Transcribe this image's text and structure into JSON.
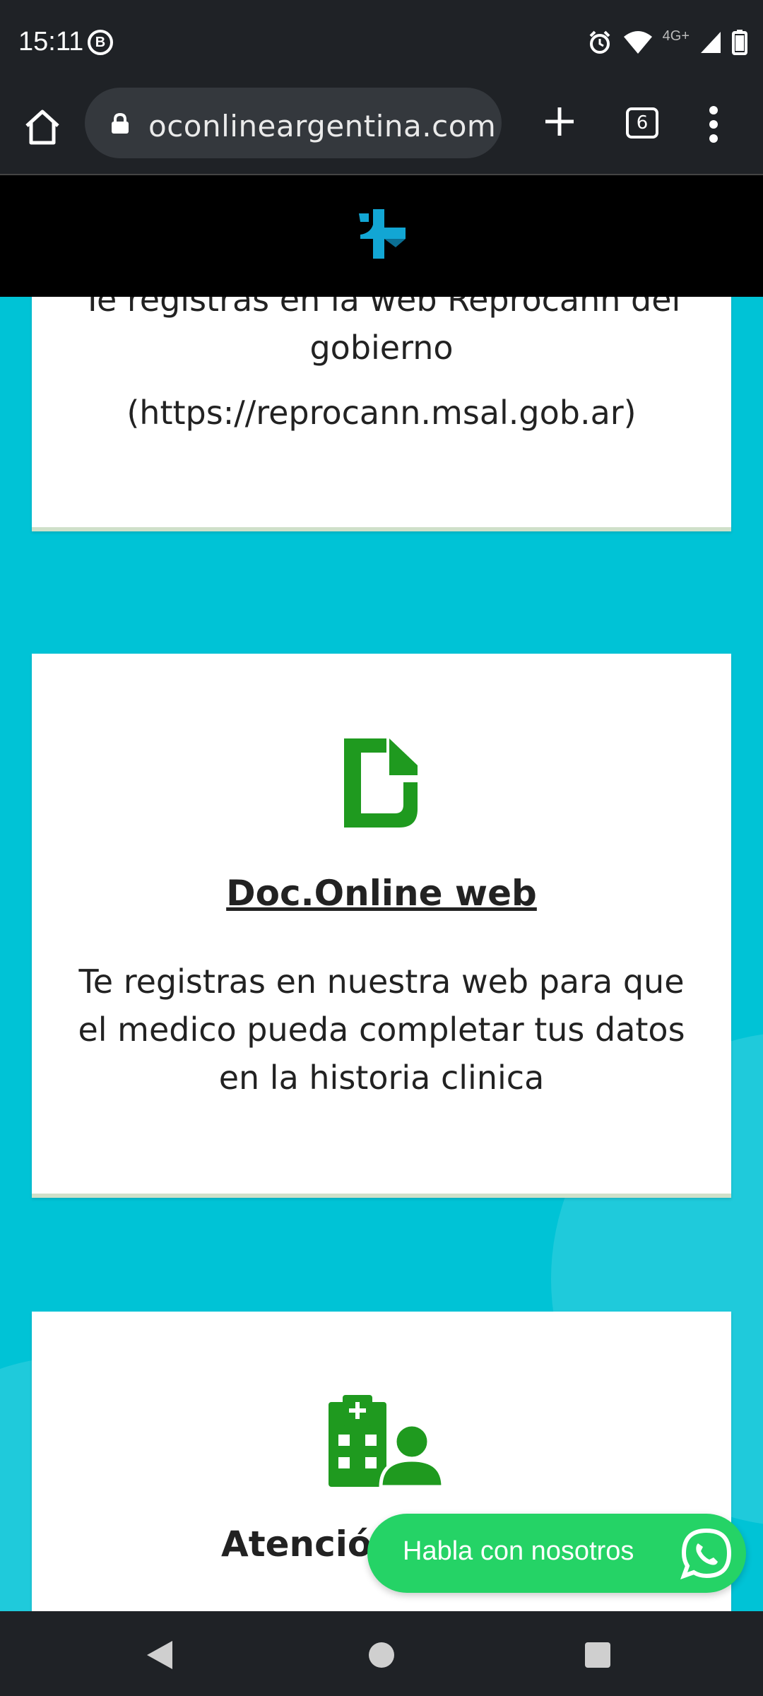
{
  "status_bar": {
    "time": "15:11",
    "badge": "B",
    "network": "4G+"
  },
  "browser": {
    "url": "oconlineargentina.com",
    "tab_count": "6"
  },
  "cards": [
    {
      "text": "Te registras en la web Reprocann del gobierno",
      "link_text": "(https://reprocann.msal.gob.ar)"
    },
    {
      "title": "Doc.Online web",
      "description": "Te registras en nuestra web para que el medico pueda completar tus datos en la historia clinica"
    },
    {
      "title": "Atención"
    }
  ],
  "whatsapp": {
    "label": "Habla con nosotros"
  },
  "colors": {
    "page_background": "#00c3d6",
    "accent_green": "#1f9a1f",
    "whatsapp_green": "#25d366",
    "header_black": "#000000"
  }
}
